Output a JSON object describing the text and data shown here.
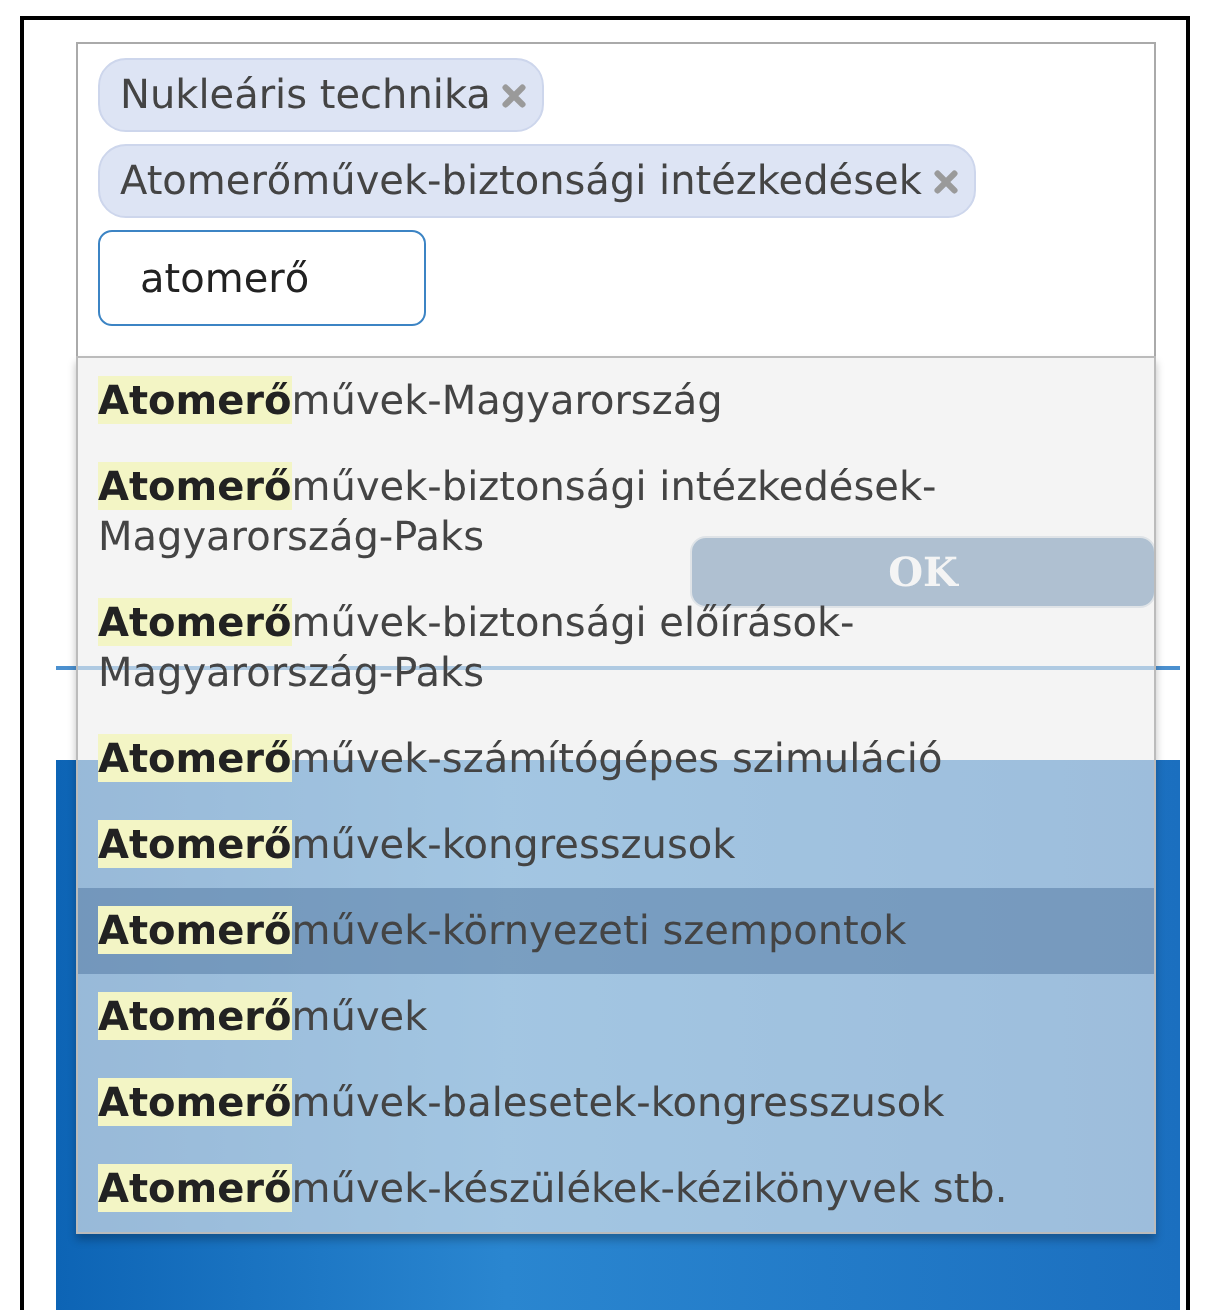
{
  "tags": [
    {
      "label": "Nukleáris technika"
    },
    {
      "label": "Atomerőművek-biztonsági intézkedések"
    }
  ],
  "search_input": {
    "value": "atomerő"
  },
  "ok_button": {
    "label": "OK"
  },
  "suggestions": [
    {
      "text": "**Atomerő**művek-Magyarország",
      "selected": false
    },
    {
      "text": "**Atomerő**művek-biztonsági intézkedések-Magyarország-Paks",
      "selected": false
    },
    {
      "text": "**Atomerő**művek-biztonsági előírások-Magyarország-Paks",
      "selected": false
    },
    {
      "text": "**Atomerő**művek-számítógépes szimuláció",
      "selected": false
    },
    {
      "text": "**Atomerő**művek-kongresszusok",
      "selected": false
    },
    {
      "text": "**Atomerő**művek-környezeti szempontok",
      "selected": true
    },
    {
      "text": "**Atomerő**művek",
      "selected": false
    },
    {
      "text": "**Atomerő**művek-balesetek-kongresszusok",
      "selected": false
    },
    {
      "text": "**Atomerő**művek-készülékek-kézikönyvek stb.",
      "selected": false
    }
  ]
}
